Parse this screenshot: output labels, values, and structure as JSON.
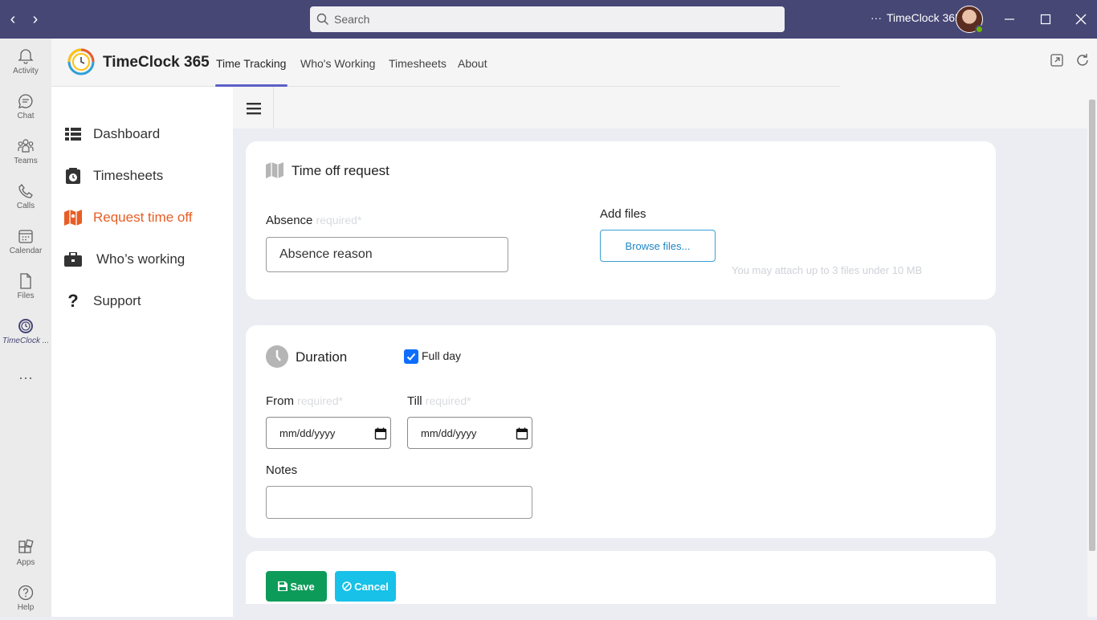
{
  "topbar": {
    "search_placeholder": "Search",
    "app_title": "TimeClock 365",
    "more_label": "···"
  },
  "rail": {
    "items": [
      {
        "label": "Activity",
        "icon": "bell-icon"
      },
      {
        "label": "Chat",
        "icon": "chat-icon"
      },
      {
        "label": "Teams",
        "icon": "teams-icon"
      },
      {
        "label": "Calls",
        "icon": "phone-icon"
      },
      {
        "label": "Calendar",
        "icon": "calendar-icon"
      },
      {
        "label": "Files",
        "icon": "file-icon"
      },
      {
        "label": "TimeClock ...",
        "icon": "clock-icon"
      }
    ],
    "more": "···",
    "bottom": [
      {
        "label": "Apps",
        "icon": "apps-icon"
      },
      {
        "label": "Help",
        "icon": "help-icon"
      }
    ]
  },
  "header": {
    "brand": "TimeClock 365",
    "tabs": [
      "Time Tracking",
      "Who's Working",
      "Timesheets",
      "About"
    ],
    "active_tab": "Time Tracking"
  },
  "sidebar": {
    "items": [
      {
        "label": "Dashboard",
        "icon": "list-icon"
      },
      {
        "label": "Timesheets",
        "icon": "timesheet-icon"
      },
      {
        "label": "Request time off",
        "icon": "map-icon"
      },
      {
        "label": "Who’s working",
        "icon": "briefcase-icon"
      },
      {
        "label": "Support",
        "icon": "question-icon"
      }
    ],
    "active": "Request time off",
    "active_color": "#e85d25"
  },
  "form": {
    "title": "Time off request",
    "absence_label": "Absence",
    "required_text": "required*",
    "absence_value": "Absence reason",
    "add_files_label": "Add files",
    "browse_label": "Browse files...",
    "files_hint": "You may attach up to 3 files under 10 MB",
    "duration_title": "Duration",
    "full_day_label": "Full day",
    "full_day_checked": true,
    "from_label": "From",
    "till_label": "Till",
    "date_placeholder": "mm/dd/yyyy",
    "notes_label": "Notes",
    "notes_value": ""
  },
  "actions": {
    "save_label": "Save",
    "cancel_label": "Cancel",
    "save_color": "#0d9b5a",
    "cancel_color": "#17c1e8"
  },
  "colors": {
    "topbar": "#464775",
    "accent": "#5b5fc7"
  }
}
